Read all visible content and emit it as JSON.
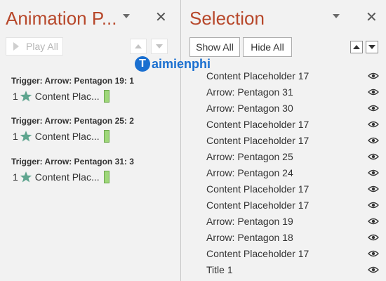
{
  "animation_pane": {
    "title": "Animation P...",
    "play_all": "Play All",
    "triggers": [
      {
        "label": "Trigger: Arrow: Pentagon 19: 1",
        "num": "1",
        "item": "Content Plac..."
      },
      {
        "label": "Trigger: Arrow: Pentagon 25: 2",
        "num": "1",
        "item": "Content Plac..."
      },
      {
        "label": "Trigger: Arrow: Pentagon 31: 3",
        "num": "1",
        "item": "Content Plac..."
      }
    ]
  },
  "selection_pane": {
    "title": "Selection",
    "show_all": "Show All",
    "hide_all": "Hide All",
    "items": [
      "Content Placeholder 17",
      "Arrow: Pentagon 31",
      "Arrow: Pentagon 30",
      "Content Placeholder 17",
      "Content Placeholder 17",
      "Arrow: Pentagon 25",
      "Arrow: Pentagon 24",
      "Content Placeholder 17",
      "Content Placeholder 17",
      "Arrow: Pentagon 19",
      "Arrow: Pentagon 18",
      "Content Placeholder 17",
      "Title 1"
    ]
  },
  "watermark": {
    "badge": "T",
    "text": "aimienphi"
  },
  "icons": {
    "close": "close-icon",
    "star": "star-icon",
    "eye": "eye-icon",
    "play": "play-icon"
  },
  "colors": {
    "title": "#b7472a",
    "star": "#5fa58f",
    "timing_bar": "#9fd77a",
    "watermark": "#1a6fd0"
  }
}
